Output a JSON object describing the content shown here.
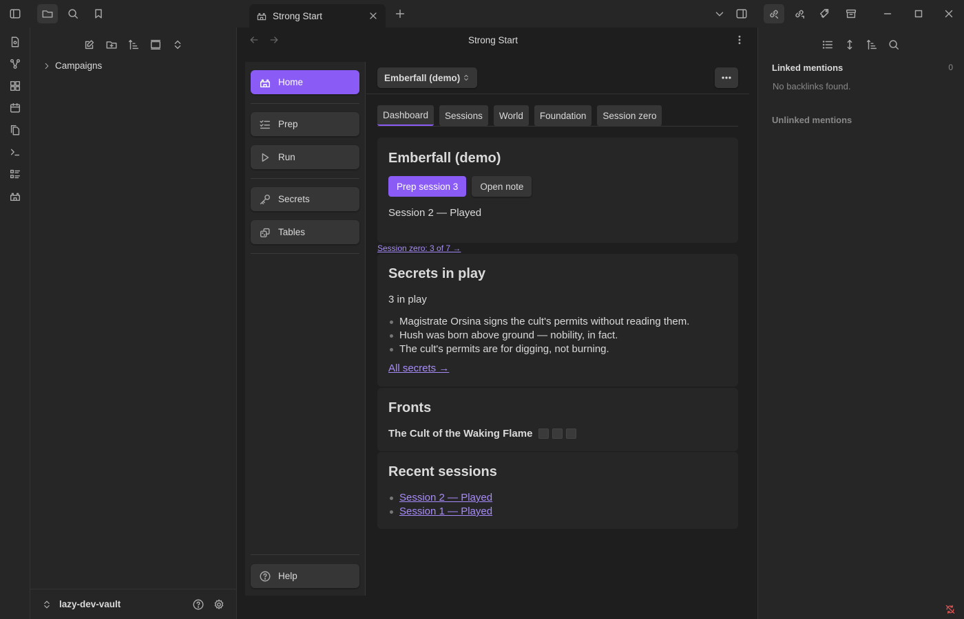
{
  "window": {
    "tab_title": "Strong Start"
  },
  "file_tree": {
    "folder": "Campaigns"
  },
  "vault": {
    "name": "lazy-dev-vault"
  },
  "view": {
    "title": "Strong Start"
  },
  "nav": {
    "items": [
      {
        "label": "Home",
        "icon": "castle-icon"
      },
      {
        "label": "Prep",
        "icon": "list-checks-icon"
      },
      {
        "label": "Run",
        "icon": "play-icon"
      },
      {
        "label": "Secrets",
        "icon": "key-icon"
      },
      {
        "label": "Tables",
        "icon": "dice-icon"
      }
    ],
    "help": "Help"
  },
  "toolbar": {
    "campaign": "Emberfall (demo)"
  },
  "tabs": [
    "Dashboard",
    "Sessions",
    "World",
    "Foundation",
    "Session zero"
  ],
  "overview": {
    "title": "Emberfall (demo)",
    "prep_button": "Prep session 3",
    "open_note": "Open note",
    "status": "Session 2 — Played"
  },
  "session_zero_link": "Session zero: 3 of 7 →",
  "secrets": {
    "title": "Secrets in play",
    "count": "3 in play",
    "items": [
      "Magistrate Orsina signs the cult's permits without reading them.",
      "Hush was born above ground — nobility, in fact.",
      "The cult's permits are for digging, not burning."
    ],
    "all_link": "All secrets →"
  },
  "fronts": {
    "title": "Fronts",
    "front_name": "The Cult of the Waking Flame",
    "clock_total": 3,
    "clock_filled": 0
  },
  "recent": {
    "title": "Recent sessions",
    "items": [
      "Session 2 — Played",
      "Session 1 — Played"
    ]
  },
  "backlinks": {
    "linked_title": "Linked mentions",
    "linked_count": "0",
    "empty": "No backlinks found.",
    "unlinked_title": "Unlinked mentions"
  },
  "colors": {
    "accent": "#8a5cf5",
    "link": "#a88bfa",
    "background": "#1e1e1e",
    "panel": "#262626"
  }
}
